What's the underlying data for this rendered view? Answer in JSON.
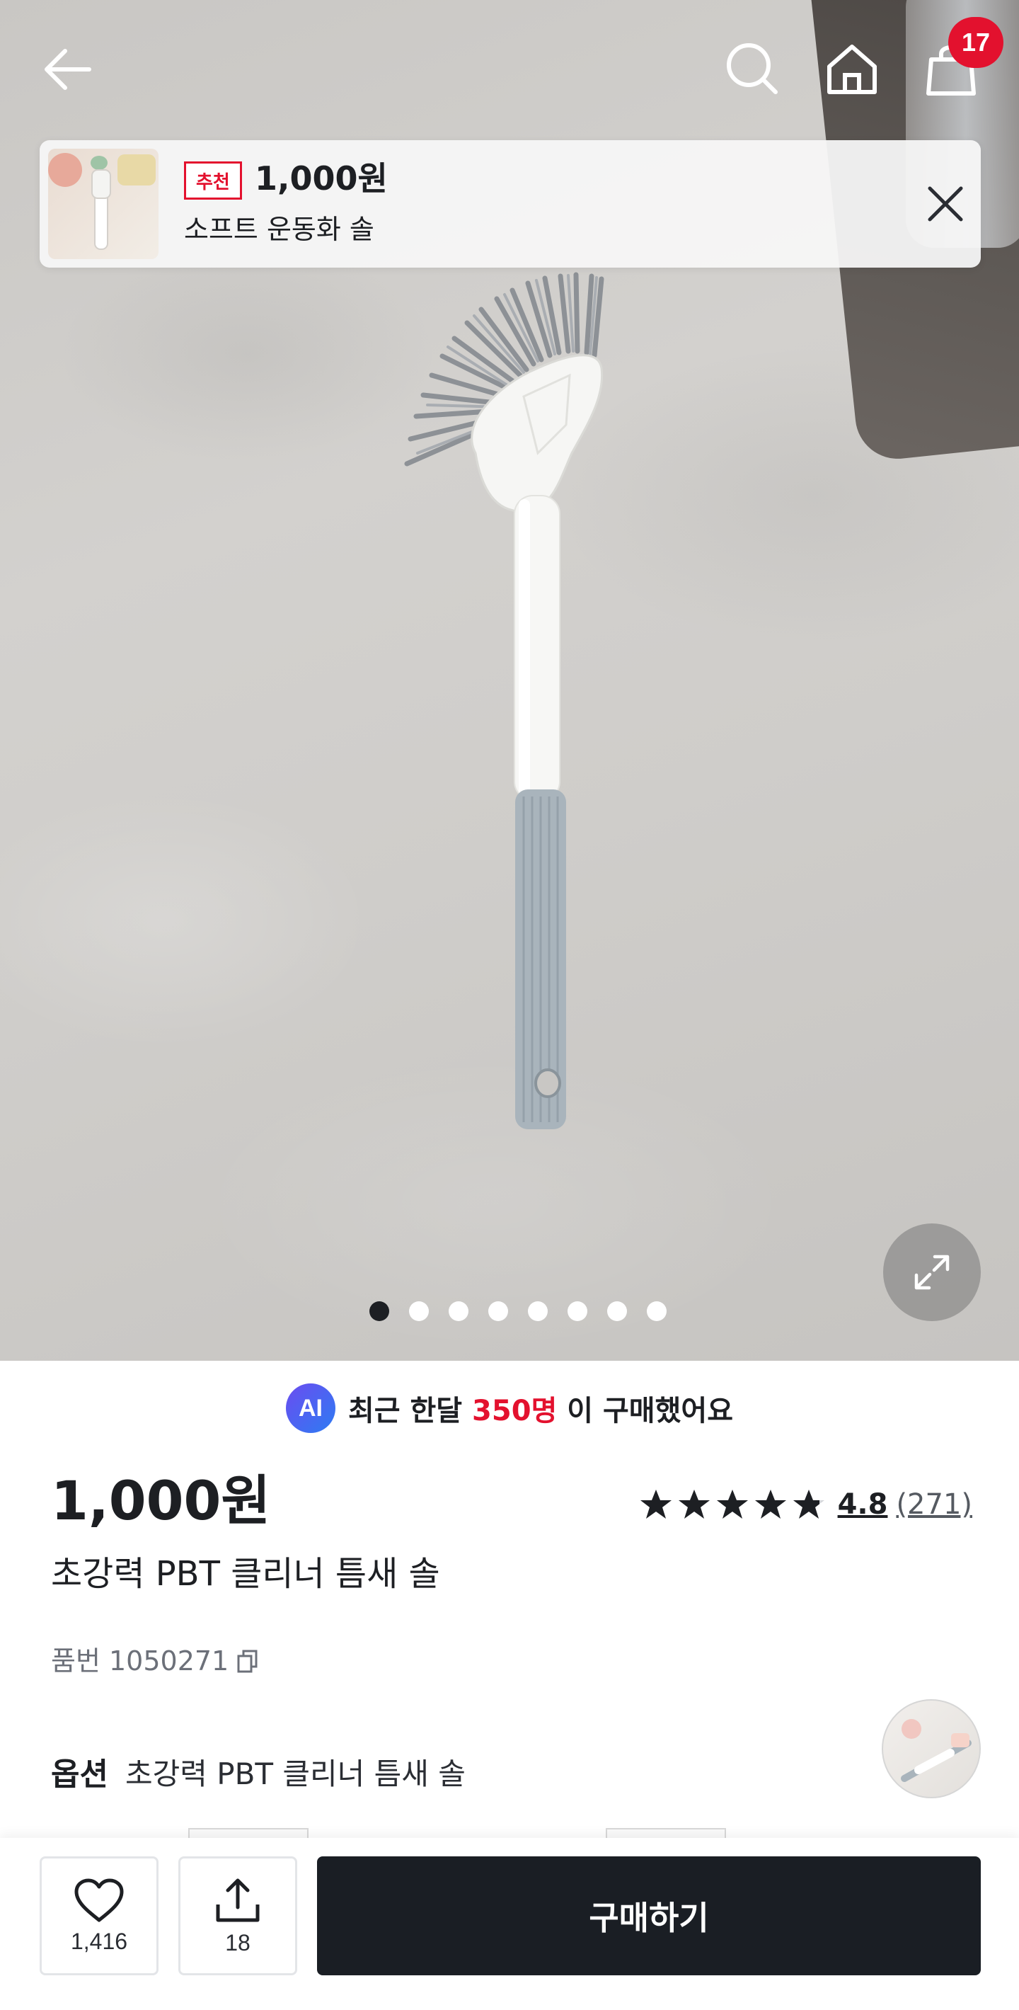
{
  "header": {
    "cart_count": "17",
    "icons": [
      "arrow-left-icon",
      "search-icon",
      "home-icon",
      "shopping-bag-icon"
    ]
  },
  "recommendation": {
    "tag": "추천",
    "price": "1,000원",
    "name": "소프트 운동화 솔"
  },
  "gallery": {
    "total_images": 8,
    "active_index": 0
  },
  "purchase_notice": {
    "badge": "AI",
    "prefix": "최근 한달",
    "count": "350명",
    "suffix": "이 구매했어요"
  },
  "product": {
    "price": "1,000원",
    "rating": "4.8",
    "rating_count": "(271)",
    "star_rating": 4.8,
    "title": "초강력 PBT 클리너 틈새 솔",
    "sku": "품번 1050271",
    "option_label": "옵션",
    "option_value": "초강력 PBT 클리너 틈새 솔"
  },
  "actions": {
    "likes": "1,416",
    "shares": "18",
    "buy_label": "구매하기"
  },
  "colors": {
    "accent_red": "#e3112e",
    "buy_button": "#1a1e24",
    "ai_gradient_start": "#6b4cf0",
    "ai_gradient_end": "#2d7cf3"
  }
}
